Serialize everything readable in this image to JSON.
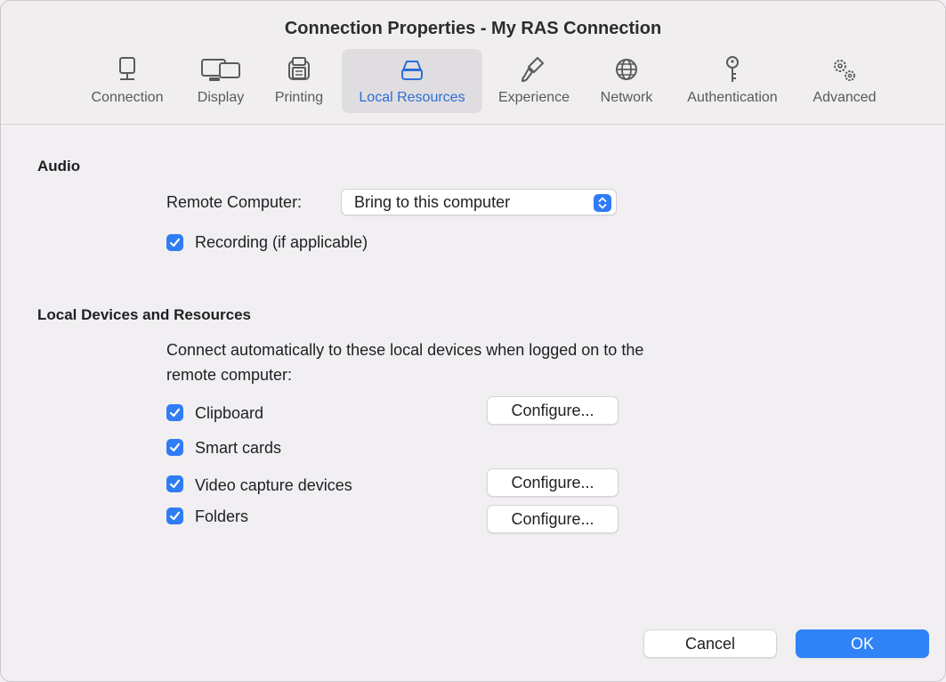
{
  "window": {
    "title": "Connection Properties - My RAS Connection"
  },
  "toolbar": {
    "tabs": [
      {
        "label": "Connection",
        "icon": "monitor-icon"
      },
      {
        "label": "Display",
        "icon": "displays-icon"
      },
      {
        "label": "Printing",
        "icon": "printer-icon"
      },
      {
        "label": "Local Resources",
        "icon": "drive-icon",
        "selected": true
      },
      {
        "label": "Experience",
        "icon": "brush-icon"
      },
      {
        "label": "Network",
        "icon": "globe-icon"
      },
      {
        "label": "Authentication",
        "icon": "key-icon"
      },
      {
        "label": "Advanced",
        "icon": "gears-icon"
      }
    ]
  },
  "audio": {
    "title": "Audio",
    "remote_label": "Remote Computer:",
    "remote_value": "Bring to this computer",
    "recording_label": "Recording (if applicable)",
    "recording_checked": true
  },
  "devices": {
    "title": "Local Devices and Resources",
    "description_line1": "Connect automatically to these local devices when logged on to the",
    "description_line2": "remote computer:",
    "items": [
      {
        "label": "Clipboard",
        "checked": true,
        "configure": "Configure..."
      },
      {
        "label": "Smart cards",
        "checked": true
      },
      {
        "label": "Video capture devices",
        "checked": true,
        "configure": "Configure..."
      },
      {
        "label": "Folders",
        "checked": true,
        "configure": "Configure..."
      }
    ]
  },
  "footer": {
    "cancel": "Cancel",
    "ok": "OK"
  },
  "colors": {
    "accent": "#2f7cf5",
    "selected_tab_text": "#2b6fd6",
    "background": "#f1eff2"
  }
}
